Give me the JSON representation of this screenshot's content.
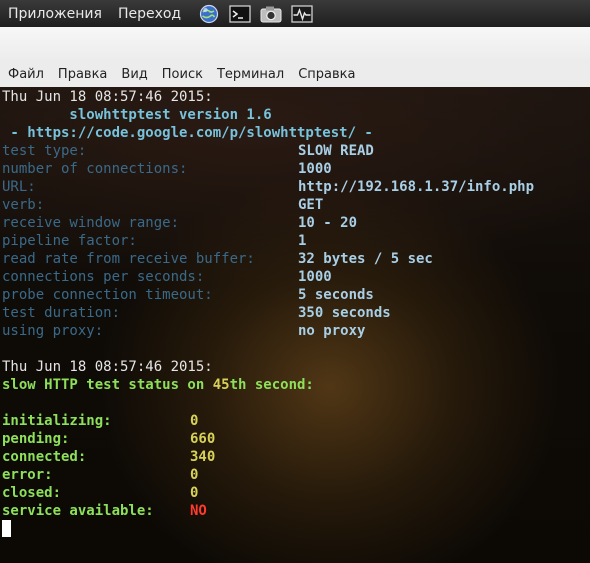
{
  "panel": {
    "apps": "Приложения",
    "places": "Переход",
    "icons": [
      "globe-browser-icon",
      "terminal-launcher-icon",
      "camera-icon",
      "system-monitor-icon"
    ]
  },
  "menubar": [
    "Файл",
    "Правка",
    "Вид",
    "Поиск",
    "Терминал",
    "Справка"
  ],
  "terminal": {
    "header_date": "Thu Jun 18 08:57:46 2015:",
    "version": "        slowhttptest version 1.6",
    "url_line": " - https://code.google.com/p/slowhttptest/ -",
    "config": [
      {
        "key": "test type:",
        "value": "SLOW READ"
      },
      {
        "key": "number of connections:",
        "value": "1000"
      },
      {
        "key": "URL:",
        "value": "http://192.168.1.37/info.php"
      },
      {
        "key": "verb:",
        "value": "GET"
      },
      {
        "key": "receive window range:",
        "value": "10 - 20"
      },
      {
        "key": "pipeline factor:",
        "value": "1"
      },
      {
        "key": "read rate from receive buffer:",
        "value": "32 bytes / 5 sec"
      },
      {
        "key": "connections per seconds:",
        "value": "1000"
      },
      {
        "key": "probe connection timeout:",
        "value": "5 seconds"
      },
      {
        "key": "test duration:",
        "value": "350 seconds"
      },
      {
        "key": "using proxy:",
        "value": "no proxy"
      }
    ],
    "status_date": "Thu Jun 18 08:57:46 2015:",
    "status_prefix": "slow HTTP test status on ",
    "status_second": "45",
    "status_suffix": "th second:",
    "status": [
      {
        "key": "initializing:",
        "value": "0"
      },
      {
        "key": "pending:",
        "value": "660"
      },
      {
        "key": "connected:",
        "value": "340"
      },
      {
        "key": "error:",
        "value": "0"
      },
      {
        "key": "closed:",
        "value": "0"
      },
      {
        "key": "service available:",
        "value": "NO"
      }
    ],
    "colors": {
      "warning": "#ff3a2e",
      "status_text": "#8ee05a",
      "info_values": "#a8cfe6"
    }
  }
}
